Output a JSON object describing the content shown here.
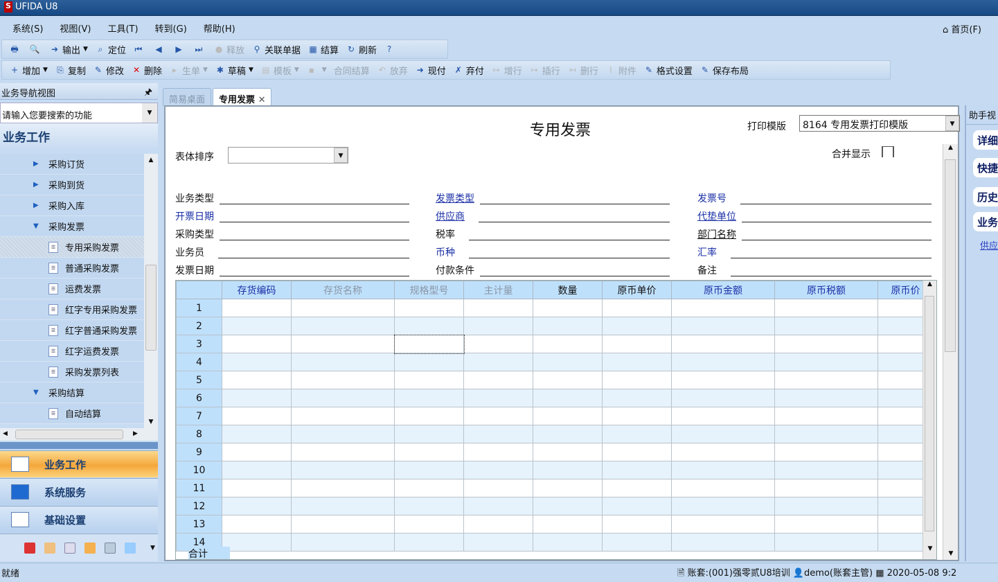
{
  "window": {
    "title": "UFIDA U8"
  },
  "menu": [
    "系统(S)",
    "视图(V)",
    "工具(T)",
    "转到(G)",
    "帮助(H)"
  ],
  "home_label": "首页(F)",
  "toolbar1": [
    {
      "icon": "print-icon",
      "label": "",
      "dis": false
    },
    {
      "icon": "preview-icon",
      "label": "",
      "dis": false
    },
    {
      "icon": "export-icon",
      "label": "输出",
      "dis": false,
      "caret": true
    },
    {
      "icon": "locate-icon",
      "label": "定位",
      "dis": false
    },
    {
      "icon": "first-icon",
      "label": "",
      "dis": false
    },
    {
      "icon": "prev-icon",
      "label": "",
      "dis": false
    },
    {
      "icon": "next-icon",
      "label": "",
      "dis": false
    },
    {
      "icon": "last-icon",
      "label": "",
      "dis": false
    },
    {
      "icon": "release-icon",
      "label": "释放",
      "dis": true
    },
    {
      "icon": "binoculars-icon",
      "label": "关联单据",
      "dis": false
    },
    {
      "icon": "settle-icon",
      "label": "结算",
      "dis": false
    },
    {
      "icon": "refresh-icon",
      "label": "刷新",
      "dis": false
    },
    {
      "icon": "help-icon",
      "label": "",
      "dis": false
    }
  ],
  "toolbar2": [
    {
      "icon": "add-icon",
      "label": "增加",
      "dis": false,
      "caret": true
    },
    {
      "icon": "copy-icon",
      "label": "复制",
      "dis": false
    },
    {
      "icon": "edit-icon",
      "label": "修改",
      "dis": false
    },
    {
      "icon": "delete-icon",
      "label": "删除",
      "dis": false
    },
    {
      "icon": "generate-icon",
      "label": "生单",
      "dis": true,
      "caret": true
    },
    {
      "icon": "draft-icon",
      "label": "草稿",
      "dis": false,
      "caret": true
    },
    {
      "icon": "template-icon",
      "label": "模板",
      "dis": true,
      "caret": true
    },
    {
      "icon": "save-icon",
      "label": "",
      "dis": true,
      "caret": true
    },
    {
      "icon": "",
      "label": "合同结算",
      "dis": true
    },
    {
      "icon": "abandon-icon",
      "label": "放弃",
      "dis": true
    },
    {
      "icon": "cash-pay-icon",
      "label": "现付",
      "dis": false
    },
    {
      "icon": "cancel-pay-icon",
      "label": "弃付",
      "dis": false
    },
    {
      "icon": "add-row-icon",
      "label": "增行",
      "dis": true
    },
    {
      "icon": "insert-row-icon",
      "label": "插行",
      "dis": true
    },
    {
      "icon": "delete-row-icon",
      "label": "删行",
      "dis": true
    },
    {
      "icon": "attachment-icon",
      "label": "附件",
      "dis": true
    },
    {
      "icon": "format-icon",
      "label": "格式设置",
      "dis": false
    },
    {
      "icon": "save-layout-icon",
      "label": "保存布局",
      "dis": false
    }
  ],
  "nav": {
    "header": "业务导航视图",
    "search_placeholder": "请输入您要搜索的功能",
    "section": "业务工作",
    "tree": [
      {
        "label": "采购订货",
        "type": "collapsed"
      },
      {
        "label": "采购到货",
        "type": "collapsed"
      },
      {
        "label": "采购入库",
        "type": "collapsed"
      },
      {
        "label": "采购发票",
        "type": "expanded"
      },
      {
        "label": "专用采购发票",
        "type": "leaf",
        "selected": true
      },
      {
        "label": "普通采购发票",
        "type": "leaf"
      },
      {
        "label": "运费发票",
        "type": "leaf"
      },
      {
        "label": "红字专用采购发票",
        "type": "leaf"
      },
      {
        "label": "红字普通采购发票",
        "type": "leaf"
      },
      {
        "label": "红字运费发票",
        "type": "leaf"
      },
      {
        "label": "采购发票列表",
        "type": "leaf"
      },
      {
        "label": "采购结算",
        "type": "expanded"
      },
      {
        "label": "自动结算",
        "type": "leaf"
      }
    ],
    "buttons": [
      "业务工作",
      "系统服务",
      "基础设置"
    ]
  },
  "tabs": [
    {
      "label": "简易桌面",
      "active": false
    },
    {
      "label": "专用发票",
      "active": true
    }
  ],
  "form": {
    "title": "专用发票",
    "print_template_label": "打印模版",
    "print_template_value": "8164 专用发票打印模版",
    "sort_label": "表体排序",
    "merge_label": "合并显示",
    "fields": [
      [
        "业务类型",
        "发票类型",
        "发票号"
      ],
      [
        "开票日期",
        "供应商",
        "代垫单位"
      ],
      [
        "采购类型",
        "税率",
        "部门名称"
      ],
      [
        "业务员",
        "币种",
        "汇率"
      ],
      [
        "发票日期",
        "付款条件",
        "备注"
      ]
    ],
    "columns": [
      "存货编码",
      "存货名称",
      "规格型号",
      "主计量",
      "数量",
      "原币单价",
      "原币金额",
      "原币税额",
      "原币价"
    ],
    "rows": [
      "1",
      "2",
      "3",
      "4",
      "5",
      "6",
      "7",
      "8",
      "9",
      "10",
      "11",
      "12",
      "13",
      "14"
    ],
    "total_label": "合计"
  },
  "assistant": {
    "header": "助手视",
    "buttons": [
      "详细",
      "快捷",
      "历史",
      "业务"
    ],
    "link": "供应"
  },
  "status": {
    "ready": "就绪",
    "account": "账套:(001)强零贰U8培训",
    "user": "demo(账套主管)",
    "datetime": "2020-05-08 9:2"
  }
}
